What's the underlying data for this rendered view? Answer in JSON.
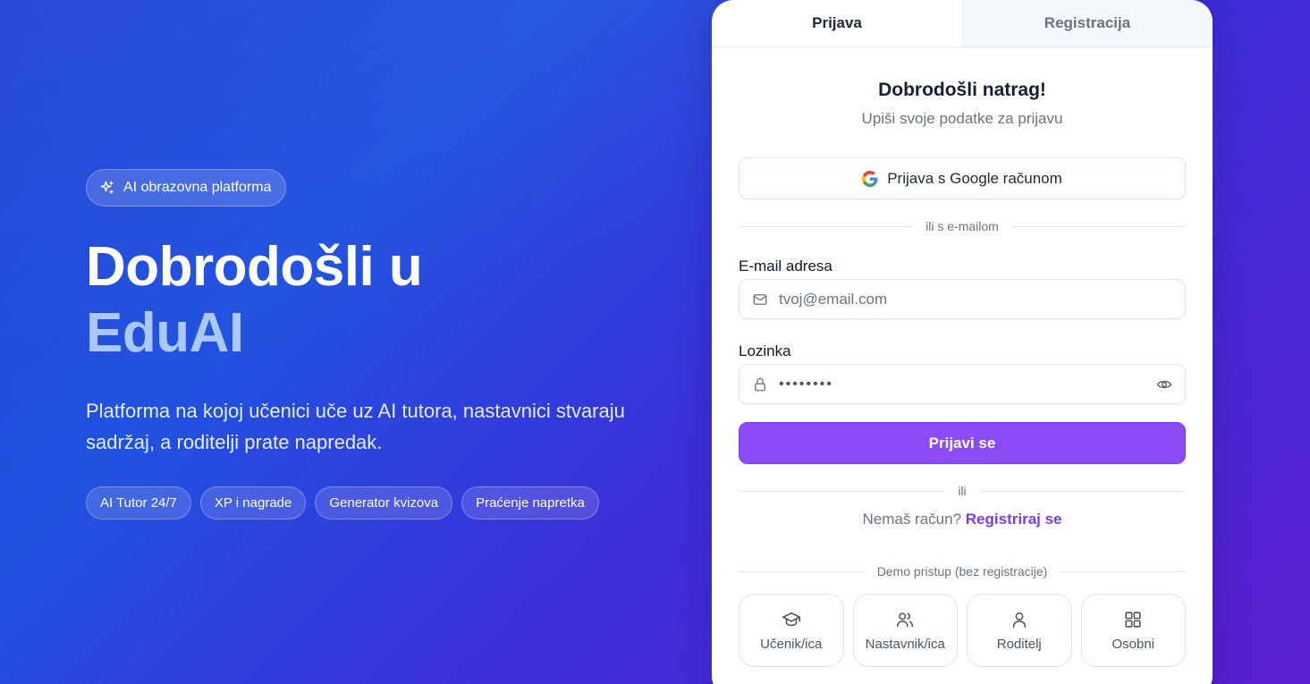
{
  "hero": {
    "badge_icon": "sparkles-icon",
    "badge_label": "AI obrazovna platforma",
    "title_line1": "Dobrodošli u",
    "title_line2": "EduAI",
    "subtitle": "Platforma na kojoj učenici uče uz AI tutora, nastavnici stvaraju sadržaj, a roditelji prate napredak.",
    "chips": [
      "AI Tutor 24/7",
      "XP i nagrade",
      "Generator kvizova",
      "Praćenje napretka"
    ]
  },
  "card": {
    "tabs": [
      {
        "label": "Prijava",
        "active": true
      },
      {
        "label": "Registracija",
        "active": false
      }
    ],
    "title": "Dobrodošli natrag!",
    "subtitle": "Upiši svoje podatke za prijavu",
    "google_button": "Prijava s Google računom",
    "divider_email": "ili s e-mailom",
    "email": {
      "label": "E-mail adresa",
      "placeholder": "tvoj@email.com",
      "icon": "mail-icon"
    },
    "password": {
      "label": "Lozinka",
      "value": "••••••••",
      "icon": "lock-icon",
      "toggle_icon": "eye-icon"
    },
    "submit_label": "Prijavi se",
    "divider_or": "ili",
    "signup_prompt": "Nemaš račun?",
    "signup_link": "Registriraj se",
    "divider_demo": "Demo pristup (bez registracije)",
    "demo_roles": [
      {
        "label": "Učenik/ica",
        "icon": "graduation-cap-icon"
      },
      {
        "label": "Nastavnik/ica",
        "icon": "users-icon"
      },
      {
        "label": "Roditelj",
        "icon": "user-icon"
      },
      {
        "label": "Osobni",
        "icon": "grid-icon"
      }
    ]
  },
  "colors": {
    "accent": "#8b4cf7",
    "link": "#7c3aed",
    "title_accent": "#a8c8ff"
  }
}
